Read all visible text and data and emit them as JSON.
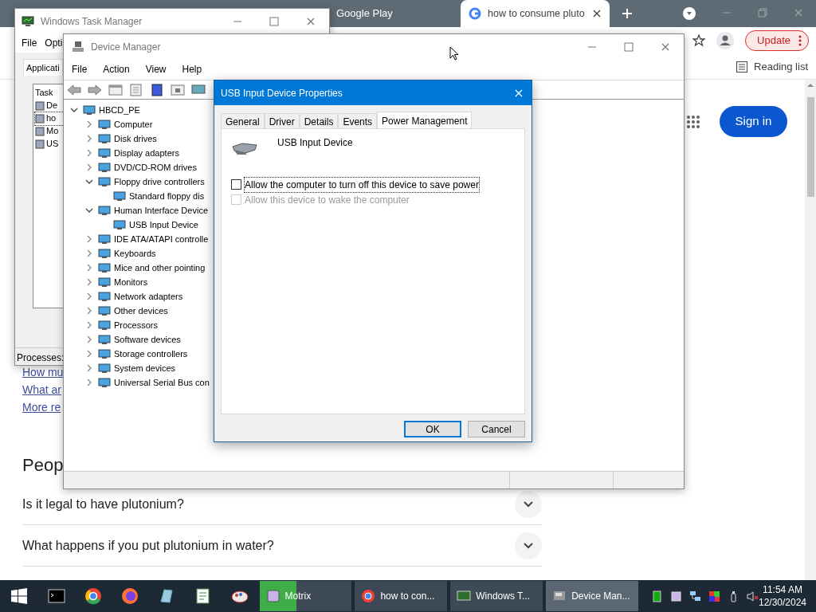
{
  "browser": {
    "tabs": [
      {
        "label": "Google Play",
        "selected": false
      },
      {
        "label": "how to consume pluto",
        "selected": true
      }
    ],
    "update_button": "Update",
    "reading_list": "Reading list",
    "sign_in": "Sign in",
    "links": [
      "How mu",
      "What ar",
      "More re"
    ],
    "heading": "Peop",
    "questions": [
      "Is it legal to have plutonium?",
      "What happens if you put plutonium in water?"
    ]
  },
  "task_manager": {
    "title": "Windows Task Manager",
    "menu": [
      "File",
      "Opti"
    ],
    "tab": "Applicati",
    "column": "Task",
    "rows": [
      {
        "label": "De",
        "selected": false
      },
      {
        "label": "ho",
        "selected": true
      },
      {
        "label": "Mo",
        "selected": false
      },
      {
        "label": "US",
        "selected": false
      }
    ],
    "status": "Processes:"
  },
  "device_manager": {
    "title": "Device Manager",
    "menu": [
      "File",
      "Action",
      "View",
      "Help"
    ],
    "tree": {
      "label": "HBCD_PE",
      "expanded": true,
      "children": [
        {
          "label": "Computer",
          "expanded": false
        },
        {
          "label": "Disk drives",
          "expanded": false
        },
        {
          "label": "Display adapters",
          "expanded": false
        },
        {
          "label": "DVD/CD-ROM drives",
          "expanded": false
        },
        {
          "label": "Floppy drive controllers",
          "expanded": true,
          "children": [
            {
              "label": "Standard floppy dis"
            }
          ]
        },
        {
          "label": "Human Interface Device",
          "expanded": true,
          "children": [
            {
              "label": "USB Input Device"
            }
          ]
        },
        {
          "label": "IDE ATA/ATAPI controlle",
          "expanded": false
        },
        {
          "label": "Keyboards",
          "expanded": false
        },
        {
          "label": "Mice and other pointing",
          "expanded": false
        },
        {
          "label": "Monitors",
          "expanded": false
        },
        {
          "label": "Network adapters",
          "expanded": false
        },
        {
          "label": "Other devices",
          "expanded": false
        },
        {
          "label": "Processors",
          "expanded": false
        },
        {
          "label": "Software devices",
          "expanded": false
        },
        {
          "label": "Storage controllers",
          "expanded": false
        },
        {
          "label": "System devices",
          "expanded": false
        },
        {
          "label": "Universal Serial Bus con",
          "expanded": false
        }
      ]
    }
  },
  "dialog": {
    "title": "USB Input Device Properties",
    "tabs": [
      {
        "label": "General",
        "selected": false
      },
      {
        "label": "Driver",
        "selected": false
      },
      {
        "label": "Details",
        "selected": false
      },
      {
        "label": "Events",
        "selected": false
      },
      {
        "label": "Power Management",
        "selected": true
      }
    ],
    "device_name": "USB Input Device",
    "options": [
      {
        "label": "Allow the computer to turn off this device to save power",
        "checked": false,
        "disabled": false
      },
      {
        "label": "Allow this device to wake the computer",
        "checked": false,
        "disabled": true
      }
    ],
    "buttons": [
      "OK",
      "Cancel"
    ]
  },
  "taskbar": {
    "buttons": [
      {
        "label": "Motrix",
        "selected": false,
        "level": 0.4
      },
      {
        "label": "how to con...",
        "selected": false
      },
      {
        "label": "Windows T...",
        "selected": false
      },
      {
        "label": "Device Man...",
        "selected": true
      }
    ],
    "time": "11:54 AM",
    "date": "12/30/2024"
  }
}
